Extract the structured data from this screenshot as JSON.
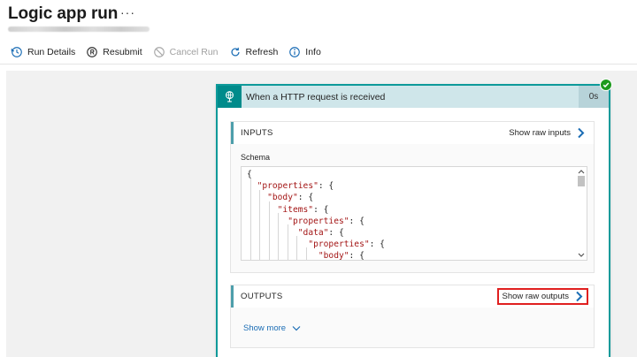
{
  "header": {
    "title": "Logic app run",
    "more_label": "···"
  },
  "toolbar": {
    "run_details": "Run Details",
    "resubmit": "Resubmit",
    "cancel_run": "Cancel Run",
    "refresh": "Refresh",
    "info": "Info"
  },
  "card": {
    "title": "When a HTTP request is received",
    "duration": "0s",
    "status": "succeeded",
    "accent_color": "#0d9a9a",
    "inputs": {
      "title": "INPUTS",
      "raw_link": "Show raw inputs",
      "schema_label": "Schema",
      "code_lines": [
        {
          "indent": "",
          "key": "",
          "text": "{"
        },
        {
          "indent": "  ",
          "key": "\"properties\"",
          "text": ": {"
        },
        {
          "indent": "    ",
          "key": "\"body\"",
          "text": ": {"
        },
        {
          "indent": "      ",
          "key": "\"items\"",
          "text": ": {"
        },
        {
          "indent": "        ",
          "key": "\"properties\"",
          "text": ": {"
        },
        {
          "indent": "          ",
          "key": "\"data\"",
          "text": ": {"
        },
        {
          "indent": "            ",
          "key": "\"properties\"",
          "text": ": {"
        },
        {
          "indent": "              ",
          "key": "\"body\"",
          "text": ": {"
        }
      ]
    },
    "outputs": {
      "title": "OUTPUTS",
      "raw_link": "Show raw outputs",
      "show_more": "Show more"
    }
  },
  "colors": {
    "highlight": "#e02020",
    "link": "#1b6db5",
    "success": "#1e9a1e"
  }
}
